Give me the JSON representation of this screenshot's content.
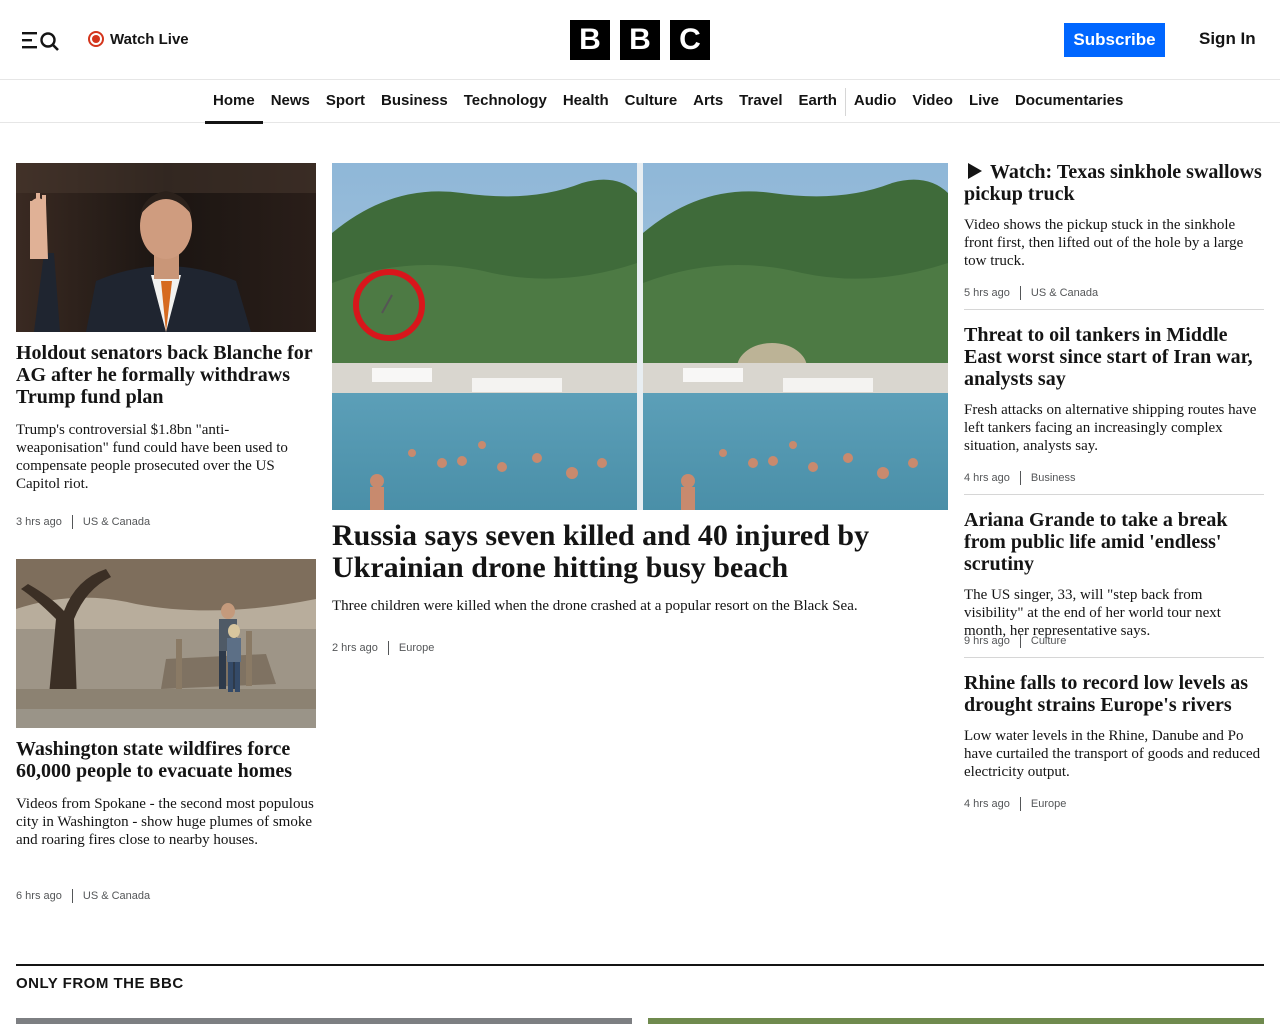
{
  "header": {
    "watch_live": "Watch Live",
    "logo_letters": [
      "B",
      "B",
      "C"
    ],
    "subscribe": "Subscribe",
    "sign_in": "Sign In"
  },
  "nav": {
    "items": [
      "Home",
      "News",
      "Sport",
      "Business",
      "Technology",
      "Health",
      "Culture",
      "Arts",
      "Travel",
      "Earth",
      "Audio",
      "Video",
      "Live",
      "Documentaries"
    ],
    "active": "Home"
  },
  "left": [
    {
      "headline": "Holdout senators back Blanche for AG after he formally withdraws Trump fund plan",
      "summary": "Trump's controversial $1.8bn \"anti-weaponisation\" fund could have been used to compensate people prosecuted over the US Capitol riot.",
      "time": "3 hrs ago",
      "section": "US & Canada"
    },
    {
      "headline": "Washington state wildfires force 60,000 people to evacuate homes",
      "summary": "Videos from Spokane - the second most populous city in Washington - show huge plumes of smoke and roaring fires close to nearby houses.",
      "time": "6 hrs ago",
      "section": "US & Canada"
    }
  ],
  "main": {
    "headline": "Russia says seven killed and 40 injured by Ukrainian drone hitting busy beach",
    "summary": "Three children were killed when the drone crashed at a popular resort on the Black Sea.",
    "time": "2 hrs ago",
    "section": "Europe"
  },
  "right": [
    {
      "headline": "Watch: Texas sinkhole swallows pickup truck",
      "summary": "Video shows the pickup stuck in the sinkhole front first, then lifted out of the hole by a large tow truck.",
      "time": "5 hrs ago",
      "section": "US & Canada"
    },
    {
      "headline": "Threat to oil tankers in Middle East worst since start of Iran war, analysts say",
      "summary": "Fresh attacks on alternative shipping routes have left tankers facing an increasingly complex situation, analysts say.",
      "time": "4 hrs ago",
      "section": "Business"
    },
    {
      "headline": "Ariana Grande to take a break from public life amid 'endless' scrutiny",
      "summary": "The US singer, 33, will \"step back from visibility\" at the end of her world tour next month, her representative says.",
      "time": "9 hrs ago",
      "section": "Culture"
    },
    {
      "headline": "Rhine falls to record low levels as drought strains Europe's rivers",
      "summary": "Low water levels in the Rhine, Danube and Po have curtailed the transport of goods and reduced electricity output.",
      "time": "4 hrs ago",
      "section": "Europe"
    }
  ],
  "section": {
    "title": "ONLY FROM THE BBC"
  },
  "colors": {
    "accent": "#0066ff",
    "live": "#d4351c",
    "text": "#141414",
    "meta": "#545658"
  }
}
